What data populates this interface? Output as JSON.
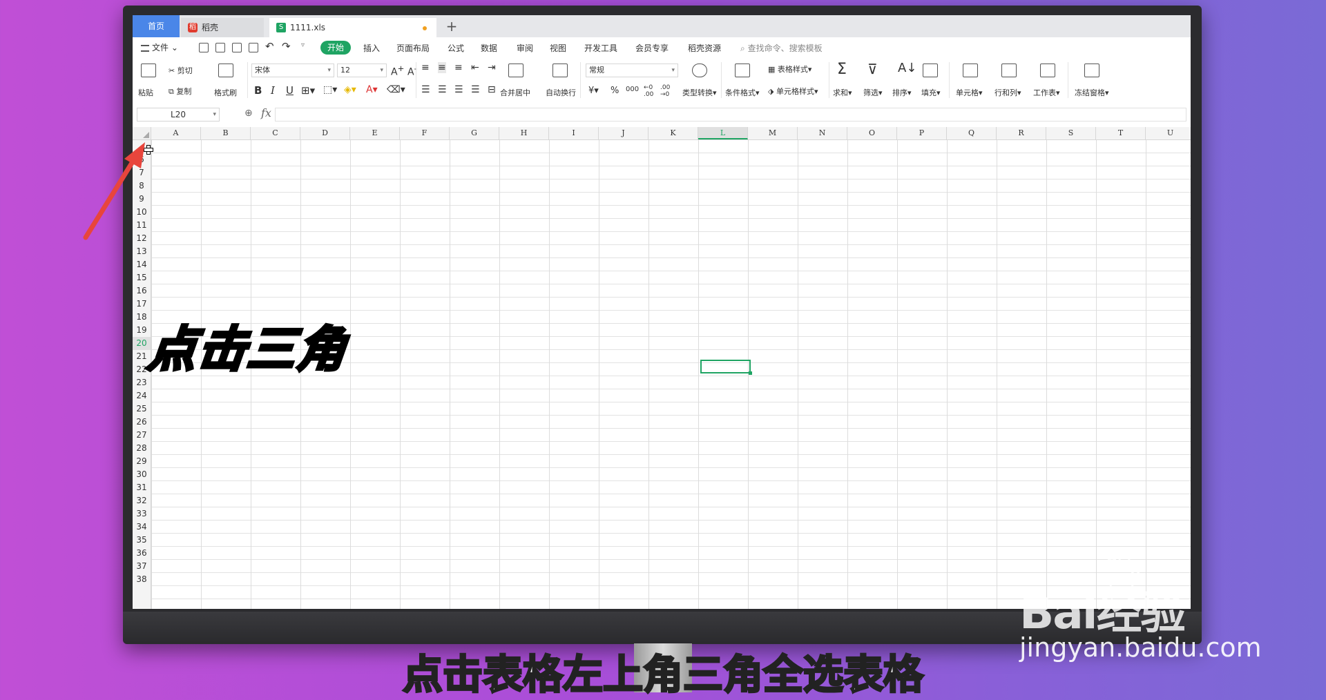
{
  "tabs": {
    "home": "首页",
    "daoke": "稻壳",
    "file": "1111.xls",
    "add": "+"
  },
  "menu": {
    "file": "文件",
    "items": [
      "开始",
      "插入",
      "页面布局",
      "公式",
      "数据",
      "审阅",
      "视图",
      "开发工具",
      "会员专享",
      "稻壳资源"
    ],
    "search_placeholder": "查找命令、搜索模板"
  },
  "ribbon": {
    "paste": "粘贴",
    "cut": "剪切",
    "copy": "复制",
    "format_painter": "格式刷",
    "font_name": "宋体",
    "font_size": "12",
    "bold": "B",
    "italic": "I",
    "underline": "U",
    "merge_center": "合并居中",
    "wrap_text": "自动换行",
    "number_format": "常规",
    "currency": "¥",
    "percent": "%",
    "thousands": "000",
    "type_convert": "类型转换",
    "conditional_format": "条件格式",
    "table_style": "表格样式",
    "cell_style": "单元格样式",
    "sum": "求和",
    "filter": "筛选",
    "sort": "排序",
    "fill": "填充",
    "cell": "单元格",
    "row_col": "行和列",
    "worksheet": "工作表",
    "freeze": "冻结窗格"
  },
  "formula_bar": {
    "name_box": "L20",
    "fx": "fx",
    "value": ""
  },
  "grid": {
    "columns": [
      "A",
      "B",
      "C",
      "D",
      "E",
      "F",
      "G",
      "H",
      "I",
      "J",
      "K",
      "L",
      "M",
      "N",
      "O",
      "P",
      "Q",
      "R",
      "S",
      "T",
      "U"
    ],
    "active_column": "L",
    "rows": [
      "6",
      "7",
      "8",
      "9",
      "10",
      "11",
      "12",
      "13",
      "14",
      "15",
      "16",
      "17",
      "18",
      "19",
      "20",
      "21",
      "22",
      "23",
      "24",
      "25",
      "26",
      "27",
      "28",
      "29",
      "30",
      "31",
      "32",
      "33",
      "34",
      "35",
      "36",
      "37",
      "38"
    ],
    "active_row": "20"
  },
  "overlay": {
    "callout": "点击三角",
    "subtitle": "点击表格左上角三角全选表格",
    "arrow_color": "#e8453c"
  },
  "watermark": {
    "logo": "Bai经验",
    "url": "jingyan.baidu.com"
  },
  "colors": {
    "accent": "#1fa463",
    "home_tab": "#4a86e8"
  }
}
